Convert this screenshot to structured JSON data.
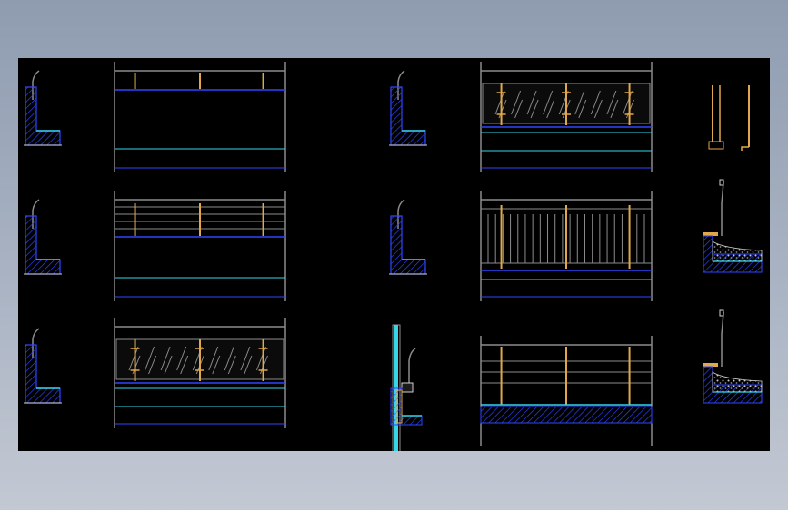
{
  "viewer": {
    "background": "gradient-blue-grey",
    "canvas_color": "#000000"
  },
  "colors": {
    "wall_blue": "#2f45ff",
    "cyan": "#36d6e8",
    "post_gold": "#e0a84a",
    "rail_grey": "#8c8c8c",
    "dark_grey": "#5a5a5a",
    "white": "#d0d0d0",
    "gravel": "#c9c9c9"
  },
  "drawing": {
    "sections": [
      {
        "name": "section-1",
        "variant": "plain"
      },
      {
        "name": "section-2",
        "variant": "plain"
      },
      {
        "name": "section-3",
        "variant": "plain"
      },
      {
        "name": "section-4",
        "variant": "plain"
      },
      {
        "name": "section-5",
        "variant": "plain"
      },
      {
        "name": "section-6",
        "variant": "curtain-wall"
      }
    ],
    "elevations": [
      {
        "name": "elevation-plain-posts",
        "infill": "none",
        "posts": 3
      },
      {
        "name": "elevation-horizontal-rails",
        "infill": "rails",
        "posts": 3
      },
      {
        "name": "elevation-glass-1",
        "infill": "glass",
        "posts": 3
      },
      {
        "name": "elevation-glass-2",
        "infill": "glass",
        "posts": 3
      },
      {
        "name": "elevation-vertical-bars",
        "infill": "bars",
        "posts": 3
      },
      {
        "name": "elevation-rails-on-slab",
        "infill": "rails-slab",
        "posts": 3
      }
    ],
    "details": [
      {
        "name": "detail-post-bracket"
      },
      {
        "name": "detail-gravel-slab-1"
      },
      {
        "name": "detail-gravel-slab-2"
      }
    ]
  }
}
